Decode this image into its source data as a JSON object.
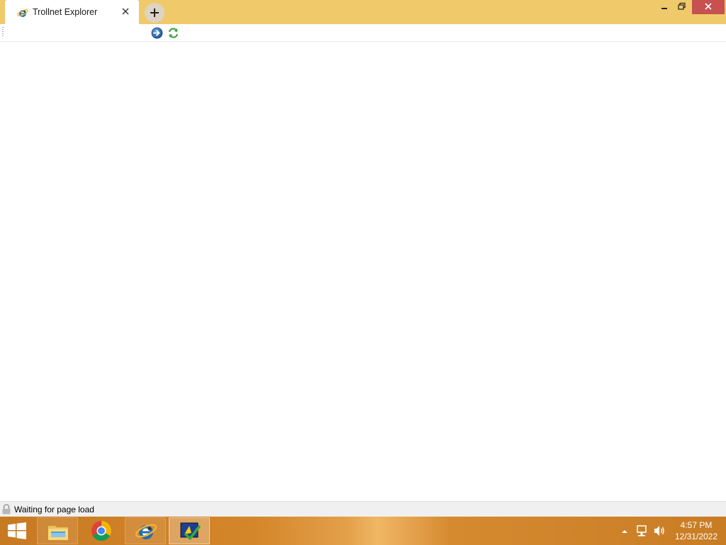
{
  "window": {
    "tab_title": "Trollnet Explorer",
    "icons": {
      "tab": "ie-logo-icon",
      "tab_close": "close-icon",
      "new_tab": "plus-icon",
      "minimize": "minimize-icon",
      "maximize": "restore-icon",
      "close": "close-icon"
    }
  },
  "toolbar": {
    "address_value": "",
    "go_icon": "go-arrow-icon",
    "refresh_icon": "refresh-icon"
  },
  "status": {
    "text": "Waiting for page load",
    "icon": "lock-icon"
  },
  "taskbar": {
    "start_icon": "windows-logo-icon",
    "apps": [
      {
        "name": "file-explorer",
        "icon": "folder-icon"
      },
      {
        "name": "chrome",
        "icon": "chrome-icon"
      },
      {
        "name": "internet-explorer",
        "icon": "ie-icon"
      },
      {
        "name": "trollnet-explorer",
        "icon": "trollnet-icon"
      }
    ],
    "tray_icons": [
      "show-hidden-icons-arrow",
      "network-icon",
      "volume-icon"
    ],
    "clock": {
      "time": "4:57 PM",
      "date": "12/31/2022"
    }
  },
  "colors": {
    "titlebar": "#f0c96a",
    "close_button": "#c75050",
    "taskbar": "#d4862a"
  }
}
